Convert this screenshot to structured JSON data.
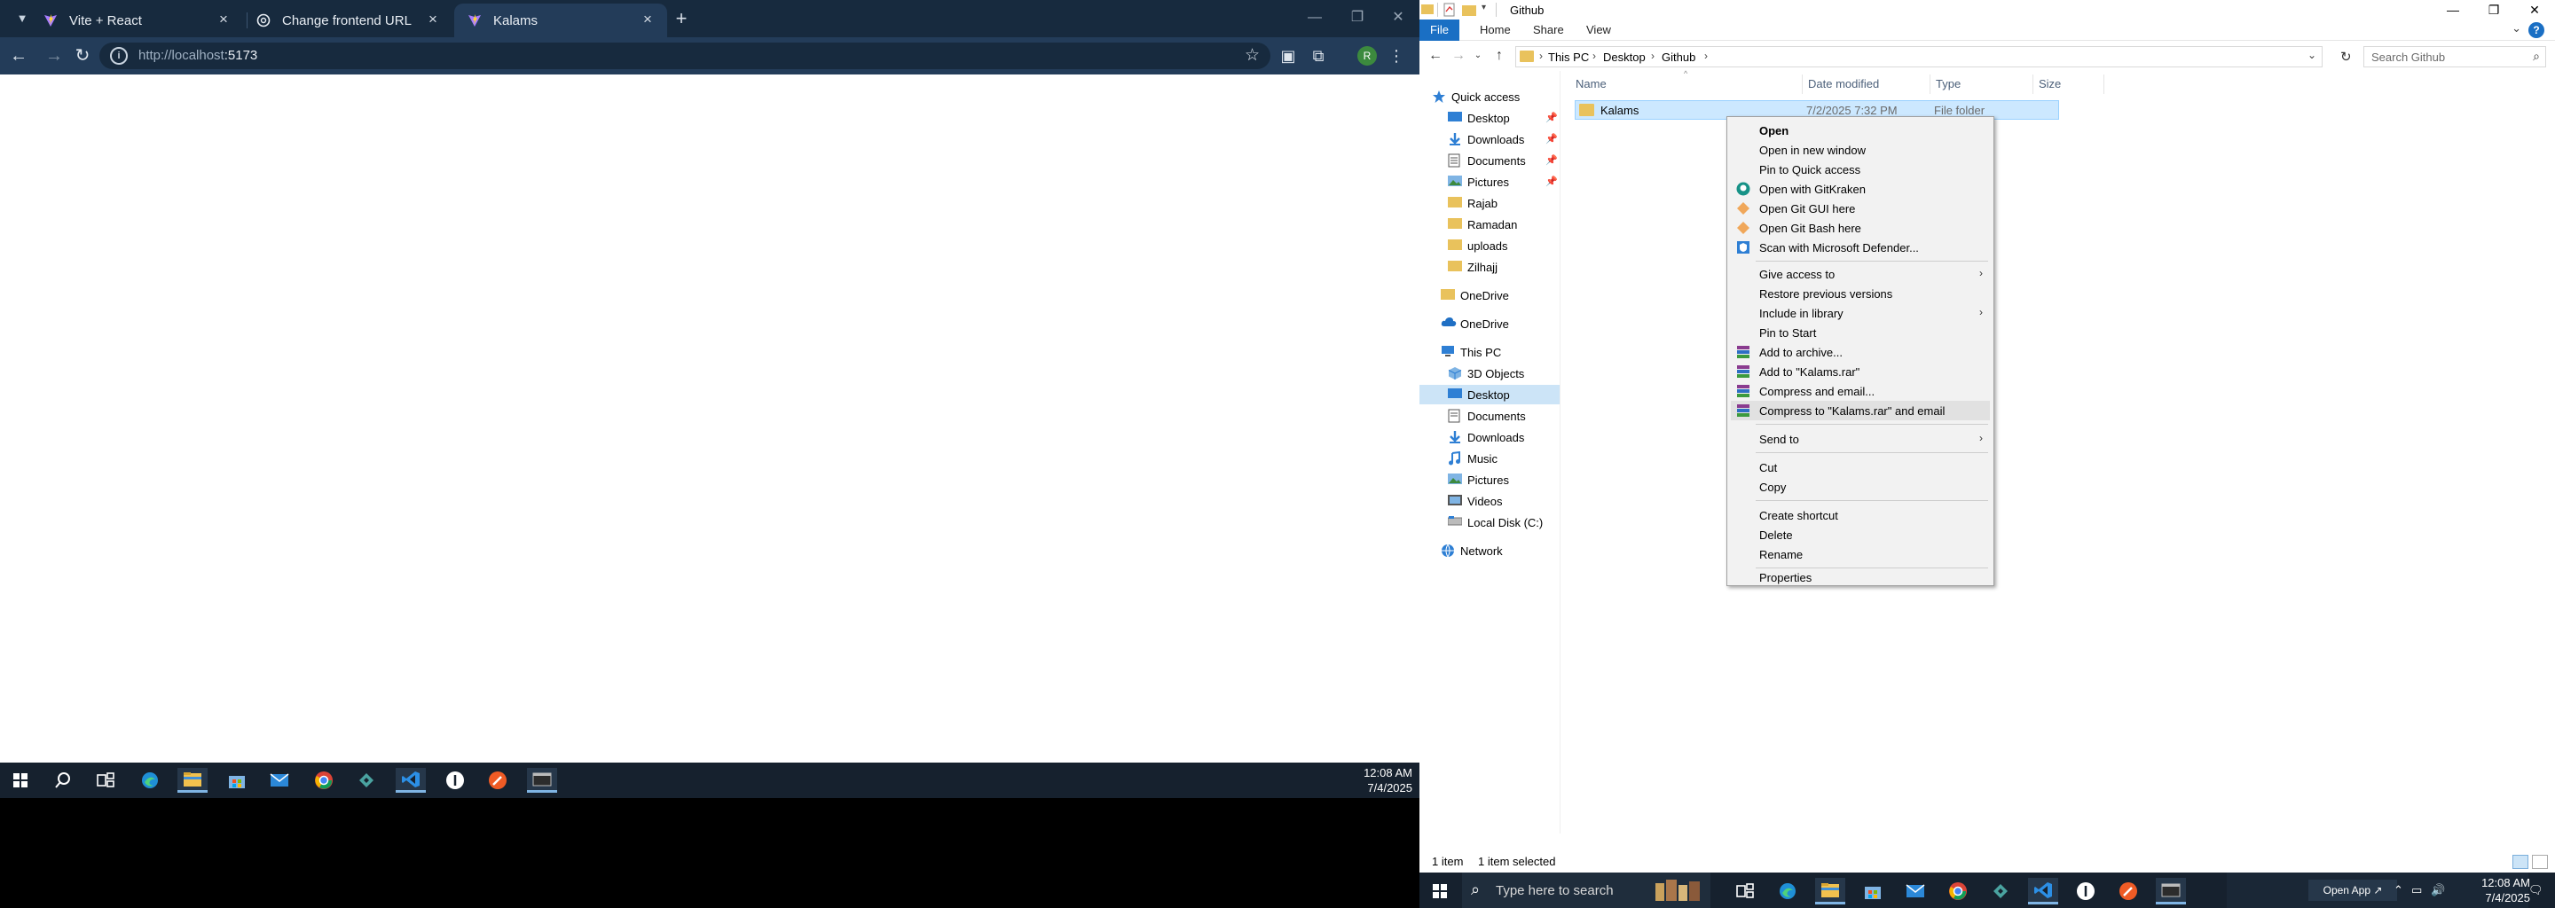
{
  "chrome": {
    "tabs": [
      {
        "label": "Vite + React",
        "icon": "vite-icon"
      },
      {
        "label": "Change frontend URL",
        "icon": "openai-icon"
      },
      {
        "label": "Kalams",
        "icon": "vite-icon"
      }
    ],
    "url_host": "http://localhost",
    "url_port": ":5173",
    "profile_initial": "R"
  },
  "left_taskbar": {
    "time": "12:08 AM",
    "date": "7/4/2025"
  },
  "explorer": {
    "title": "Github",
    "ribbon_tabs": [
      "File",
      "Home",
      "Share",
      "View"
    ],
    "breadcrumb": [
      "This PC",
      "Desktop",
      "Github"
    ],
    "search_placeholder": "Search Github",
    "columns": [
      "Name",
      "Date modified",
      "Type",
      "Size"
    ],
    "nav": {
      "quick_access": "Quick access",
      "qa_items": [
        "Desktop",
        "Downloads",
        "Documents",
        "Pictures",
        "Rajab",
        "Ramadan",
        "uploads",
        "Zilhajj"
      ],
      "onedrive_personal": "OneDrive",
      "onedrive": "OneDrive",
      "this_pc": "This PC",
      "pc_items": [
        "3D Objects",
        "Desktop",
        "Documents",
        "Downloads",
        "Music",
        "Pictures",
        "Videos",
        "Local Disk (C:)"
      ],
      "network": "Network"
    },
    "rows": [
      {
        "name": "Kalams",
        "date": "7/2/2025 7:32 PM",
        "type": "File folder",
        "size": ""
      }
    ],
    "status": {
      "count": "1 item",
      "selected": "1 item selected"
    }
  },
  "context_menu": {
    "items": [
      "Open",
      "Open in new window",
      "Pin to Quick access",
      "Open with GitKraken",
      "Open Git GUI here",
      "Open Git Bash here",
      "Scan with Microsoft Defender...",
      "Give access to",
      "Restore previous versions",
      "Include in library",
      "Pin to Start",
      "Add to archive...",
      "Add to \"Kalams.rar\"",
      "Compress and email...",
      "Compress to \"Kalams.rar\" and email",
      "Send to",
      "Cut",
      "Copy",
      "Create shortcut",
      "Delete",
      "Rename",
      "Properties"
    ]
  },
  "right_taskbar": {
    "search_placeholder": "Type here to search",
    "open_app": "Open App",
    "time": "12:08 AM",
    "date": "7/4/2025"
  }
}
